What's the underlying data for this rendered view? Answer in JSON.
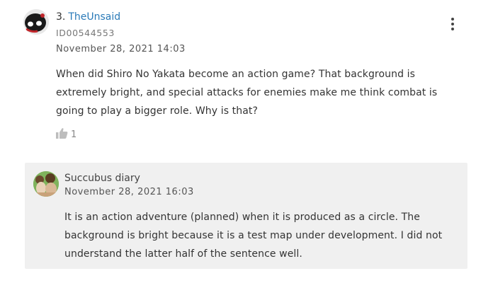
{
  "comment": {
    "number": "3.",
    "username": "TheUnsaid",
    "user_id": "ID00544553",
    "date": "November 28, 2021 14:03",
    "text": "When did Shiro No Yakata become an action game? That background is extremely bright, and special attacks for enemies make me think combat is going to play a bigger role. Why is that?",
    "like_count": "1",
    "menu_icon": "kebab-menu-icon",
    "like_icon": "thumbs-up-icon"
  },
  "reply": {
    "author": "Succubus diary",
    "date": "November 28, 2021 16:03",
    "text": "It is an action adventure (planned) when it is produced as a circle. The background is bright because it is a test map under development. I did not understand the latter half of the sentence well."
  },
  "colors": {
    "username_link": "#2a7ab8",
    "reply_background": "#f0f0f0"
  }
}
